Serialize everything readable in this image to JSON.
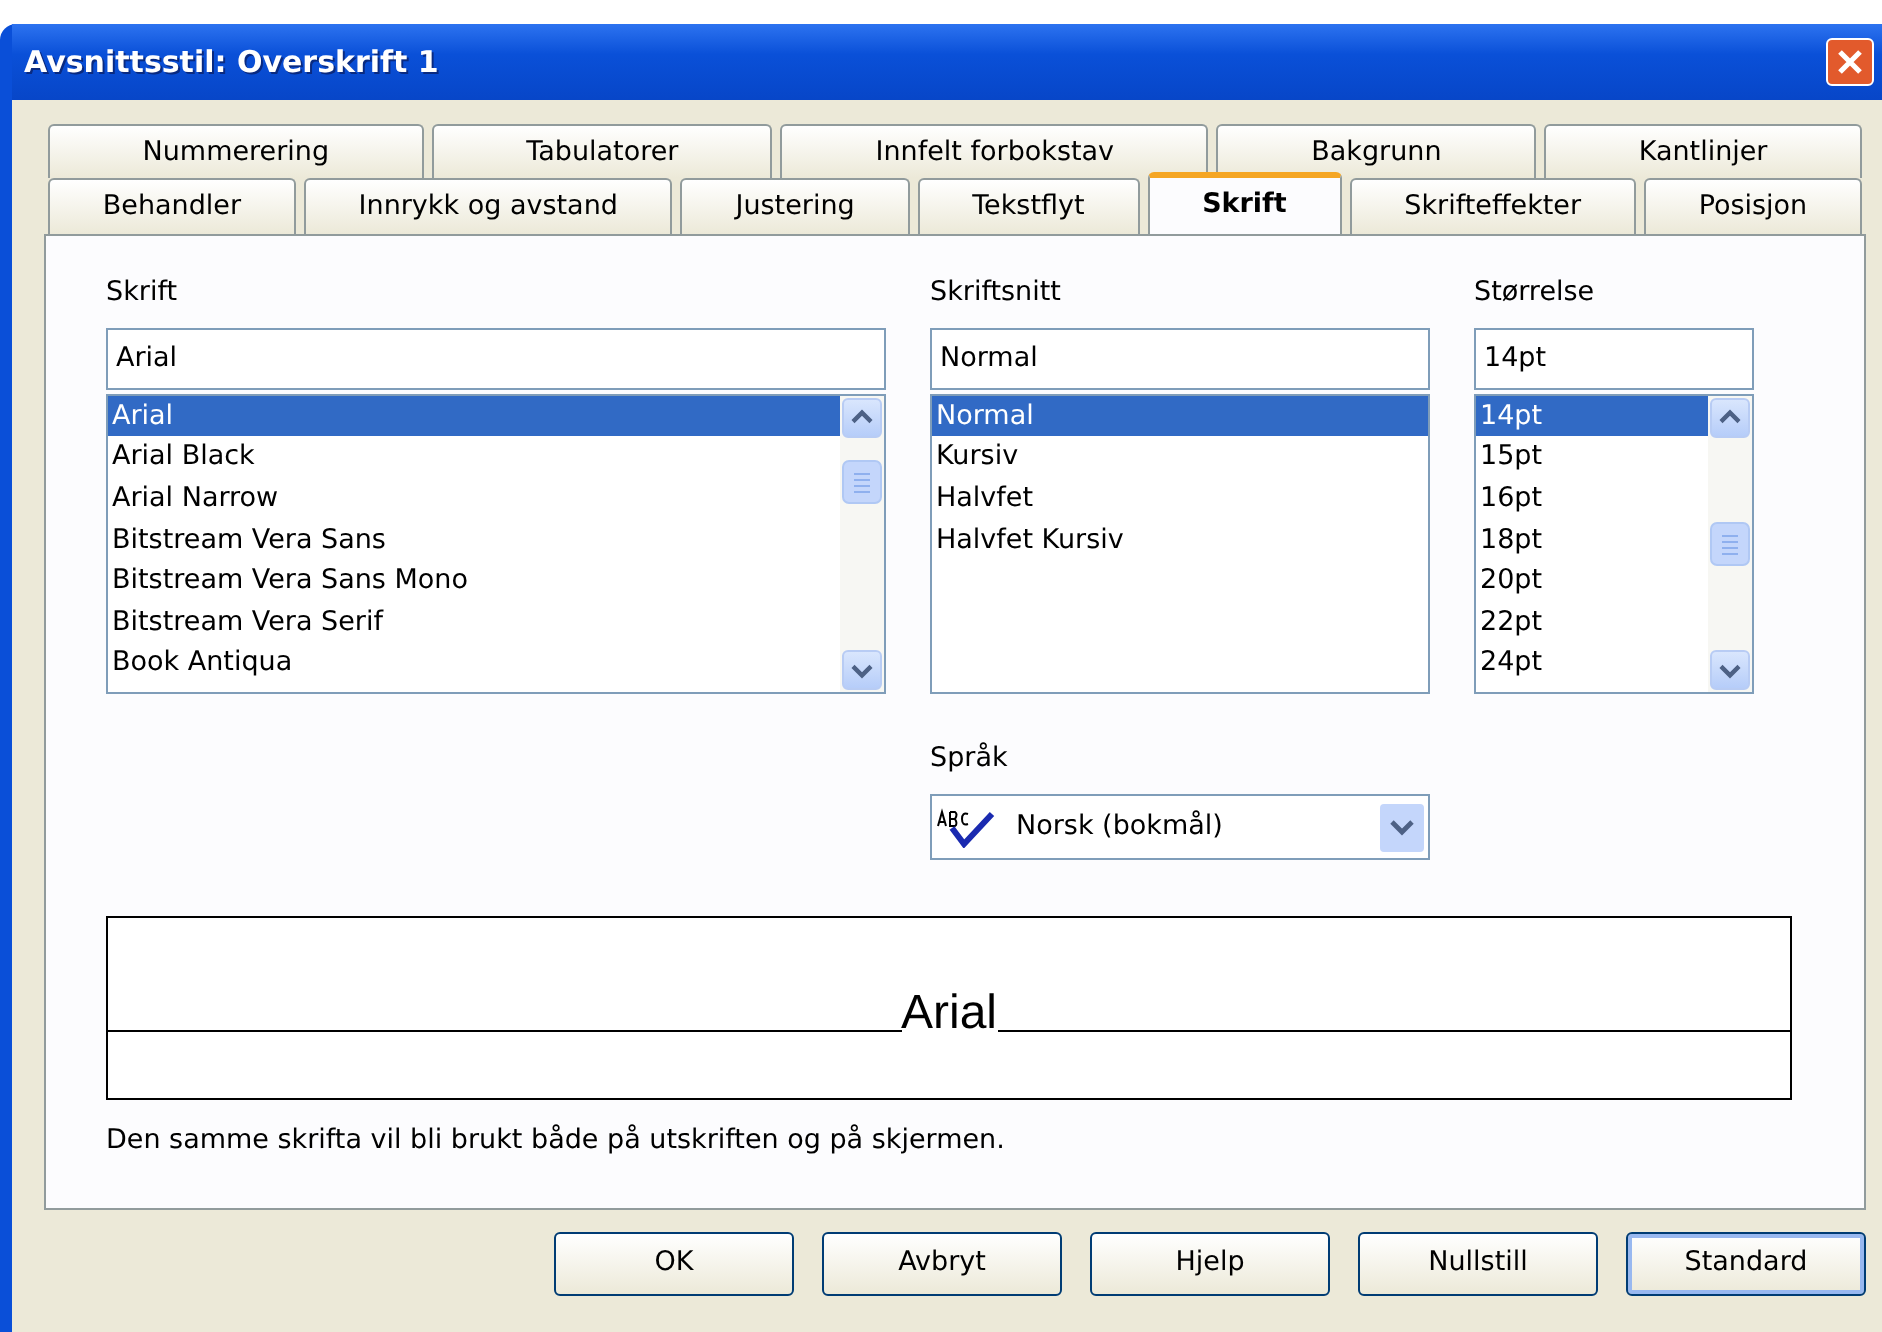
{
  "window": {
    "title": "Avsnittsstil: Overskrift 1"
  },
  "tab_rows": [
    [
      {
        "label": "Nummerering",
        "selected": false
      },
      {
        "label": "Tabulatorer",
        "selected": false
      },
      {
        "label": "Innfelt forbokstav",
        "selected": false
      },
      {
        "label": "Bakgrunn",
        "selected": false
      },
      {
        "label": "Kantlinjer",
        "selected": false
      }
    ],
    [
      {
        "label": "Behandler",
        "selected": false
      },
      {
        "label": "Innrykk og avstand",
        "selected": false
      },
      {
        "label": "Justering",
        "selected": false
      },
      {
        "label": "Tekstflyt",
        "selected": false
      },
      {
        "label": "Skrift",
        "selected": true
      },
      {
        "label": "Skrifteffekter",
        "selected": false
      },
      {
        "label": "Posisjon",
        "selected": false
      }
    ]
  ],
  "font_pickers": [
    {
      "label": "Skrift",
      "value": "Arial",
      "scrollbar": true,
      "items": [
        {
          "text": "Arial",
          "selected": true
        },
        {
          "text": "Arial Black",
          "selected": false
        },
        {
          "text": "Arial Narrow",
          "selected": false
        },
        {
          "text": "Bitstream Vera Sans",
          "selected": false
        },
        {
          "text": "Bitstream Vera Sans Mono",
          "selected": false
        },
        {
          "text": "Bitstream Vera Serif",
          "selected": false
        },
        {
          "text": "Book Antiqua",
          "selected": false
        }
      ]
    },
    {
      "label": "Skriftsnitt",
      "value": "Normal",
      "scrollbar": false,
      "items": [
        {
          "text": "Normal",
          "selected": true
        },
        {
          "text": "Kursiv",
          "selected": false
        },
        {
          "text": "Halvfet",
          "selected": false
        },
        {
          "text": "Halvfet Kursiv",
          "selected": false
        }
      ]
    },
    {
      "label": "Størrelse",
      "value": "14pt",
      "scrollbar": true,
      "items": [
        {
          "text": "14pt",
          "selected": true
        },
        {
          "text": "15pt",
          "selected": false
        },
        {
          "text": "16pt",
          "selected": false
        },
        {
          "text": "18pt",
          "selected": false
        },
        {
          "text": "20pt",
          "selected": false
        },
        {
          "text": "22pt",
          "selected": false
        },
        {
          "text": "24pt",
          "selected": false
        }
      ]
    }
  ],
  "language": {
    "label": "Språk",
    "value": "Norsk (bokmål)"
  },
  "preview": {
    "text": "Arial"
  },
  "note": "Den samme skrifta vil bli brukt både på utskriften og på skjermen.",
  "buttons": [
    {
      "label": "OK",
      "default": false
    },
    {
      "label": "Avbryt",
      "default": false
    },
    {
      "label": "Hjelp",
      "default": false
    },
    {
      "label": "Nullstill",
      "default": false
    },
    {
      "label": "Standard",
      "default": true
    }
  ]
}
